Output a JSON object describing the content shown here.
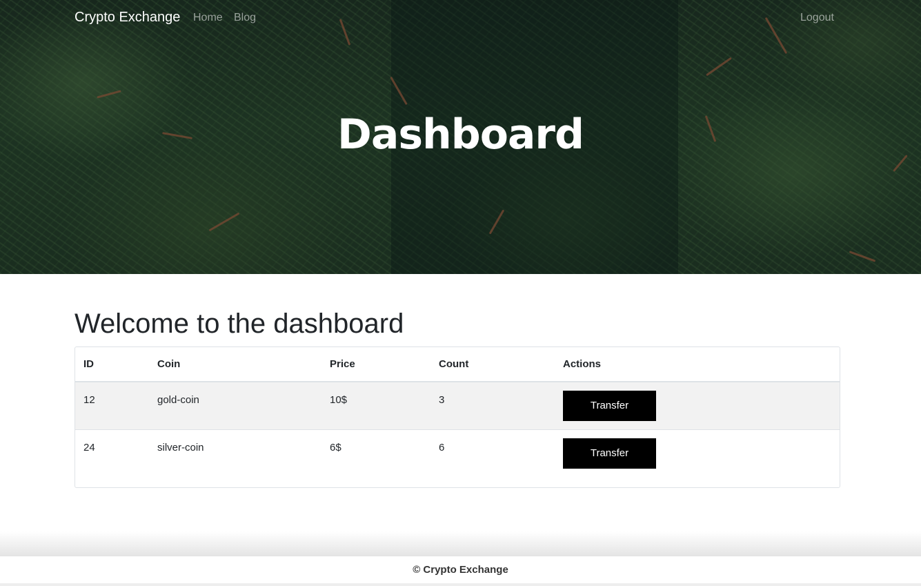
{
  "navbar": {
    "brand": "Crypto Exchange",
    "links": [
      "Home",
      "Blog"
    ],
    "logout": "Logout"
  },
  "hero": {
    "title": "Dashboard"
  },
  "main": {
    "heading": "Welcome to the dashboard",
    "table": {
      "headers": [
        "ID",
        "Coin",
        "Price",
        "Count",
        "Actions"
      ],
      "rows": [
        {
          "id": "12",
          "coin": "gold-coin",
          "price": "10$",
          "count": "3",
          "action": "Transfer"
        },
        {
          "id": "24",
          "coin": "silver-coin",
          "price": "6$",
          "count": "6",
          "action": "Transfer"
        }
      ]
    }
  },
  "footer": {
    "text": "© Crypto Exchange"
  },
  "colors": {
    "button_bg": "#000000",
    "striped_row": "#f2f2f2",
    "hero_overlay": "#0a1916"
  }
}
